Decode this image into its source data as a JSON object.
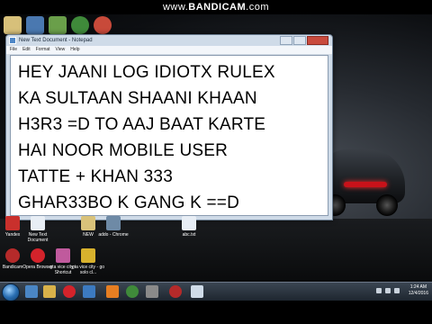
{
  "watermark": {
    "prefix": "www.",
    "brand": "BANDICAM",
    "suffix": ".com"
  },
  "notepad": {
    "title": "New Text Document - Notepad",
    "menu": [
      "File",
      "Edit",
      "Format",
      "View",
      "Help"
    ],
    "lines": [
      "HEY JAANI LOG IDIOTX RULEX",
      "KA SULTAAN SHAANI KHAAN",
      "H3R3 =D TO AAJ BAAT KARTE",
      "HAI NOOR MOBILE USER",
      "TATTE + KHAN 333",
      "GHAR33BO K GANG K ==D"
    ]
  },
  "desktop_icons": [
    {
      "label": "Yandex",
      "color": "#c9302c"
    },
    {
      "label": "New Text Document",
      "color": "#e8eef5"
    },
    {
      "label": "NEW",
      "color": "#d9c27a"
    },
    {
      "label": "addo - Chrome",
      "color": "#6e8aa6"
    },
    {
      "label": "abc.txt",
      "color": "#e8eef5"
    },
    {
      "label": "Bandicam",
      "color": "#b52a2a"
    },
    {
      "label": "Opera Browser",
      "color": "#d3232b"
    },
    {
      "label": "gta vice city - Shortcut",
      "color": "#c05a9d"
    },
    {
      "label": "gta vice city - go solo cl...",
      "color": "#d7b12d"
    }
  ],
  "clock": {
    "time": "1:24 AM",
    "date": "12/4/2016"
  },
  "colors": {
    "taskbar": "#1e262f",
    "notepad_frame": "#cfdbe8"
  }
}
